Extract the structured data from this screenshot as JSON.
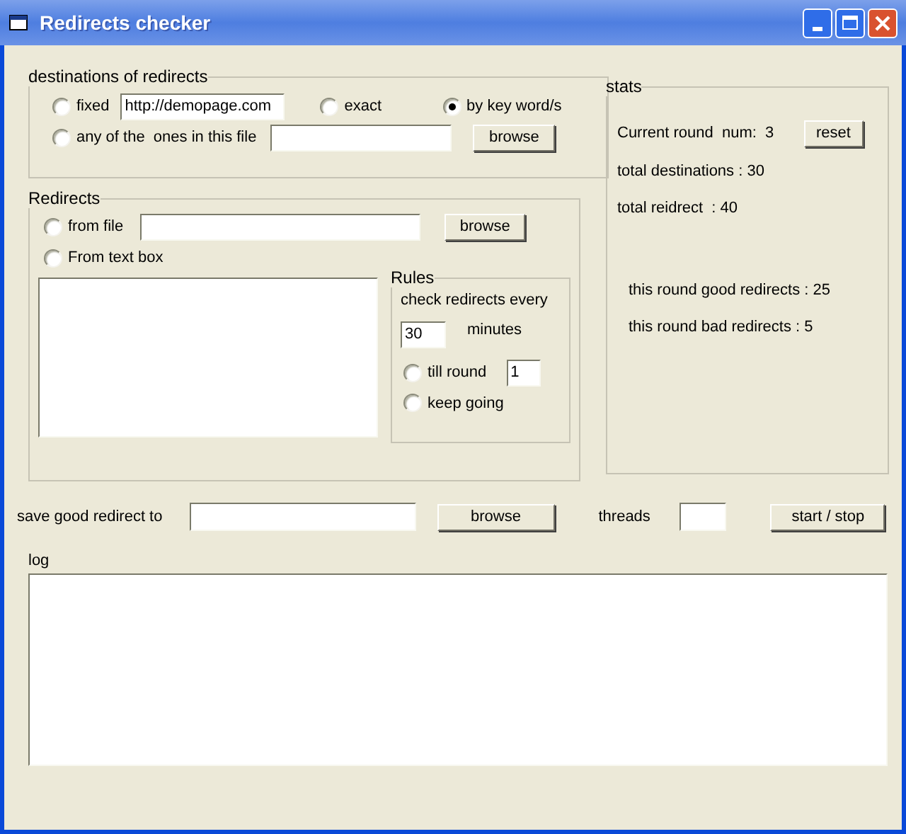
{
  "window": {
    "title": "Redirects checker"
  },
  "destinations": {
    "title": "destinations of redirects",
    "options": [
      {
        "label": "fixed",
        "selected": false
      },
      {
        "label": "exact",
        "selected": false
      },
      {
        "label": "by key word/s",
        "selected": true
      },
      {
        "label": "any of the  ones in this file",
        "selected": false
      }
    ],
    "fixed_url": "http://demopage.com",
    "browse_button": "browse"
  },
  "redirects": {
    "title": "Redirects",
    "options": [
      {
        "label": "from file",
        "selected": false
      },
      {
        "label": "From text box",
        "selected": false
      }
    ],
    "browse_button": "browse",
    "rules": {
      "title": "Rules",
      "check_label": "check redirects every",
      "interval": "30",
      "unit": "minutes",
      "options": [
        {
          "label": "till round",
          "selected": false
        },
        {
          "label": "keep going",
          "selected": false
        }
      ],
      "till_round": "1"
    }
  },
  "stats": {
    "title": "stats",
    "current_round": "Current round  num:  3",
    "reset_button": "reset",
    "totals": [
      "total destinations : 30",
      "total reidrect  : 40"
    ],
    "round_results": [
      "this round good redirects : 25",
      "this round bad redirects : 5"
    ]
  },
  "save": {
    "label": "save good redirect to",
    "browse_button": "browse"
  },
  "threads": {
    "label": "threads"
  },
  "start_stop_button": "start / stop",
  "log": {
    "label": "log"
  }
}
